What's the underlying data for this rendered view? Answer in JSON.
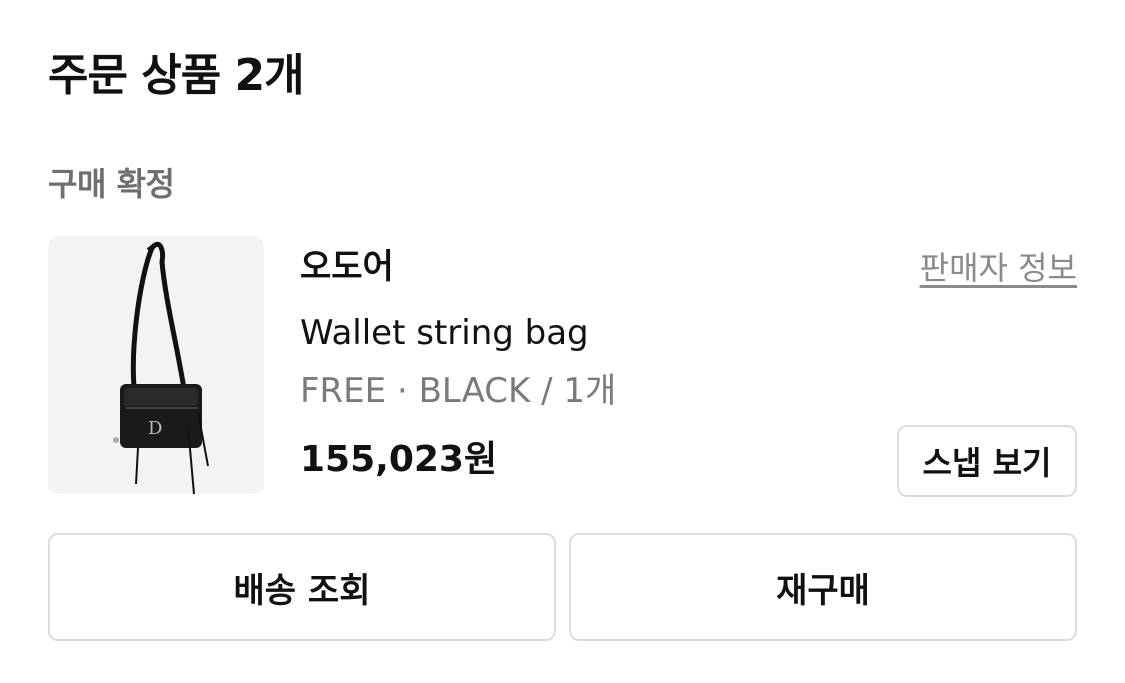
{
  "header": {
    "title": "주문 상품 2개"
  },
  "order": {
    "status": "구매 확정",
    "item": {
      "brand": "오도어",
      "seller_link": "판매자 정보",
      "name": "Wallet string bag",
      "option": "FREE · BLACK / 1개",
      "price": "155,023원",
      "snap_button": "스냅 보기",
      "image": "bag-product-image"
    }
  },
  "actions": {
    "track_delivery": "배송 조회",
    "rebuy": "재구매"
  },
  "colors": {
    "text": "#111111",
    "muted": "#7a7a7a",
    "border": "#dcdcdc",
    "thumb_bg": "#f3f3f3"
  }
}
